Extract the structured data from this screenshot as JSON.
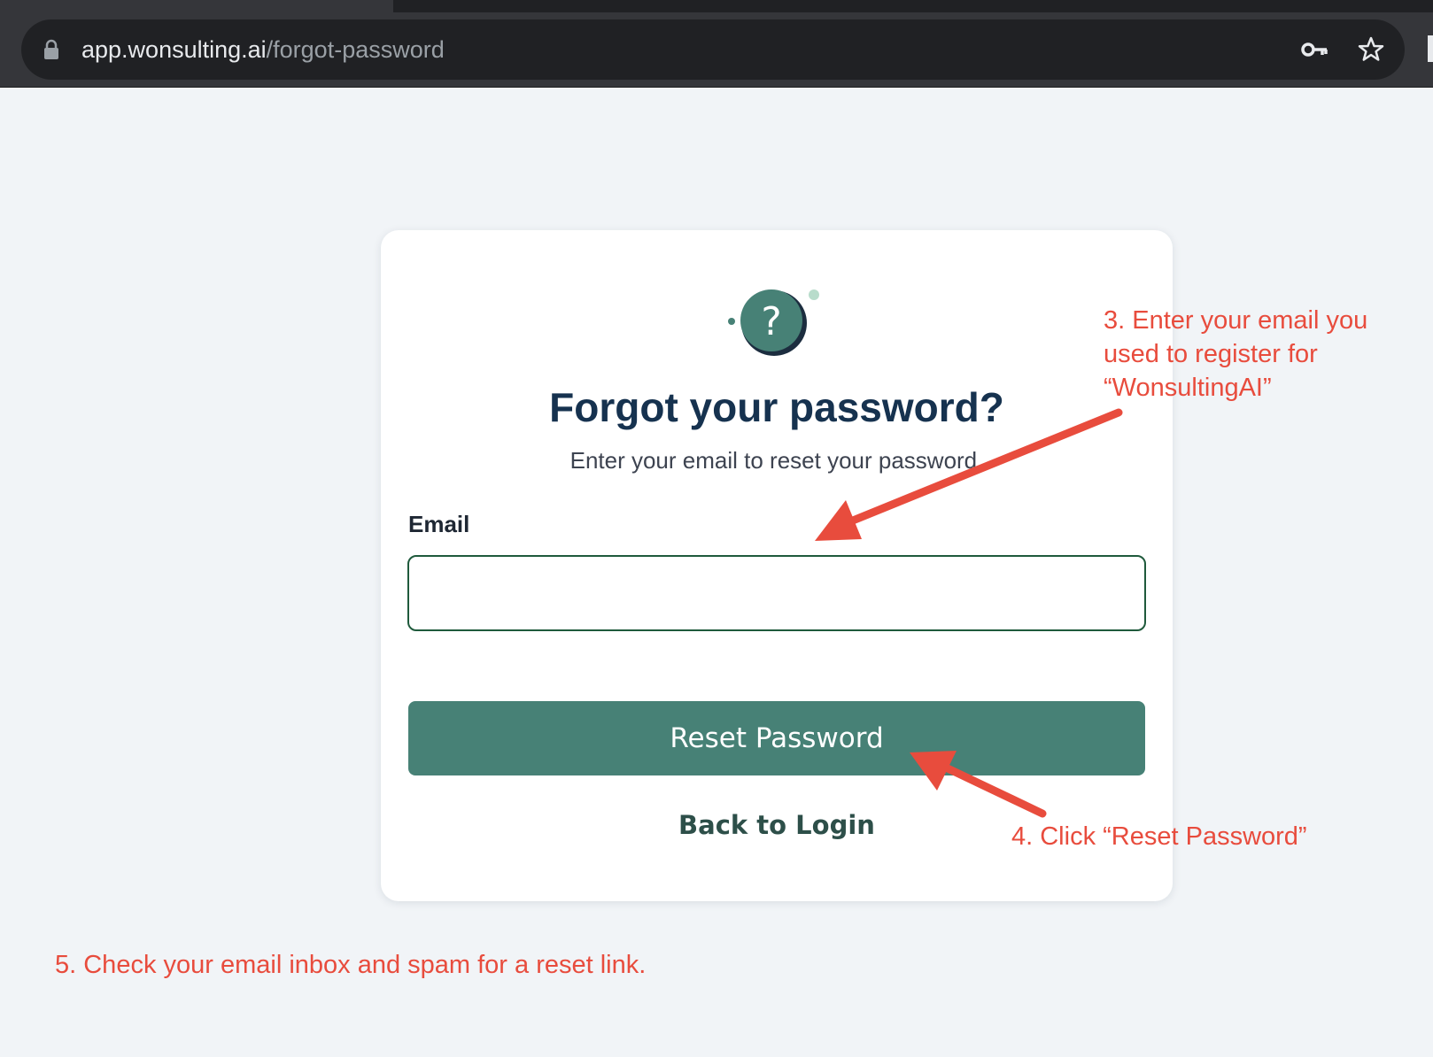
{
  "browser": {
    "url_host": "app.wonsulting.ai",
    "url_path": "/forgot-password",
    "icons": [
      "lock-icon",
      "key-icon",
      "star-icon"
    ]
  },
  "form": {
    "icon": "question-mark-icon",
    "title": "Forgot your password?",
    "subtitle": "Enter your email to reset your password.",
    "email_label": "Email",
    "email_value": "",
    "reset_button_label": "Reset Password",
    "back_link_label": "Back to Login"
  },
  "annotations": {
    "step3_lines": [
      "3. Enter your email you",
      "used to register for",
      "“WonsultingAI”"
    ],
    "step4": "4. Click “Reset Password”",
    "step5": "5. Check your email inbox and spam for a reset link."
  },
  "colors": {
    "page_background": "#f1f4f7",
    "title": "#16324f",
    "button": "#478176",
    "input_border": "#1f5a3c",
    "annotation": "#e84c3d"
  }
}
